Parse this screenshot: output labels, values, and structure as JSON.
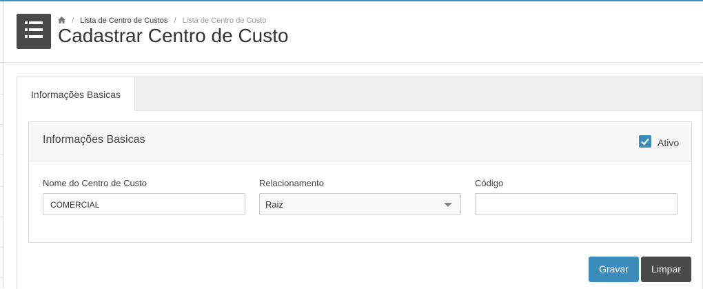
{
  "breadcrumb": {
    "home_icon": "home-icon",
    "items": [
      "Lista de Centro de Custos",
      "Lista de Centro de Custo"
    ]
  },
  "header": {
    "menu_icon": "hamburger-menu-icon",
    "title": "Cadastrar Centro de Custo"
  },
  "tabs": [
    {
      "label": "Informações Basicas",
      "active": true
    }
  ],
  "panel": {
    "title": "Informações Basicas",
    "ativo": {
      "label": "Ativo",
      "checked": true,
      "icon": "checkmark-icon"
    }
  },
  "form": {
    "nome": {
      "label": "Nome do Centro de Custo",
      "value": "COMERCIAL"
    },
    "relacionamento": {
      "label": "Relacionamento",
      "value": "Raiz"
    },
    "codigo": {
      "label": "Código",
      "value": ""
    }
  },
  "actions": {
    "save_label": "Gravar",
    "clear_label": "Limpar"
  },
  "colors": {
    "accent": "#3c8dbc",
    "dark_button": "#4a4a4a"
  }
}
